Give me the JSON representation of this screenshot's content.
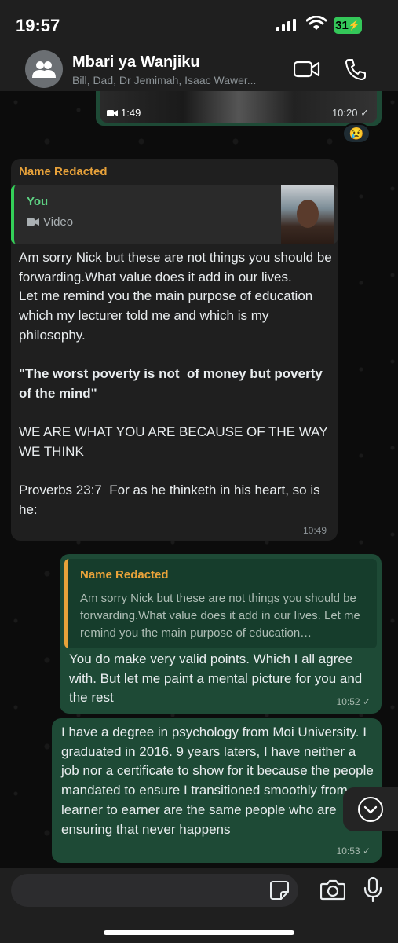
{
  "status_bar": {
    "time": "19:57",
    "battery": "31"
  },
  "header": {
    "group_name": "Mbari ya Wanjiku",
    "members": "Bill, Dad, Dr Jemimah, Isaac Wawer..."
  },
  "messages": [
    {
      "type": "video",
      "direction": "outgoing",
      "duration": "1:49",
      "time": "10:20 ✓",
      "reaction": "😢"
    },
    {
      "type": "text",
      "direction": "incoming",
      "sender": "Name Redacted",
      "quote": {
        "author": "You",
        "kind": "Video"
      },
      "line1": "Am sorry Nick but these are not things you should be forwarding.What value does it add in our lives.",
      "line2": "Let me remind you the main purpose of education which my lecturer told me and which is my philosophy.",
      "bold": "\"The worst poverty is not  of money but poverty of the mind\"",
      "line3": "WE ARE WHAT YOU ARE BECAUSE OF THE WAY WE THINK",
      "line4": "Proverbs 23:7  For as he thinketh in his heart, so is he:",
      "time": "10:49"
    },
    {
      "type": "text",
      "direction": "outgoing",
      "quote": {
        "author": "Name Redacted",
        "text": "Am sorry Nick but these are not things you should be forwarding.What value does it add in our lives. Let me remind you the main purpose of education…"
      },
      "text": "You do make very valid points. Which I all agree with. But let me paint a mental picture for you and the rest",
      "time": "10:52 ✓"
    },
    {
      "type": "text",
      "direction": "outgoing",
      "text": "I have a degree in psychology from Moi University. I graduated in 2016. 9 years laters, I have neither a job nor a certificate to show for it because the people mandated to ensure I transitioned smoothly from learner to earner are the same people who are ensuring that never happens",
      "time": "10:53 ✓"
    }
  ],
  "input": {
    "placeholder": ""
  },
  "colors": {
    "incoming_bubble": "#1f1f1f",
    "outgoing_bubble": "#1e4a36",
    "sender_name": "#e8a23a",
    "quote_you": "#5ed183"
  }
}
